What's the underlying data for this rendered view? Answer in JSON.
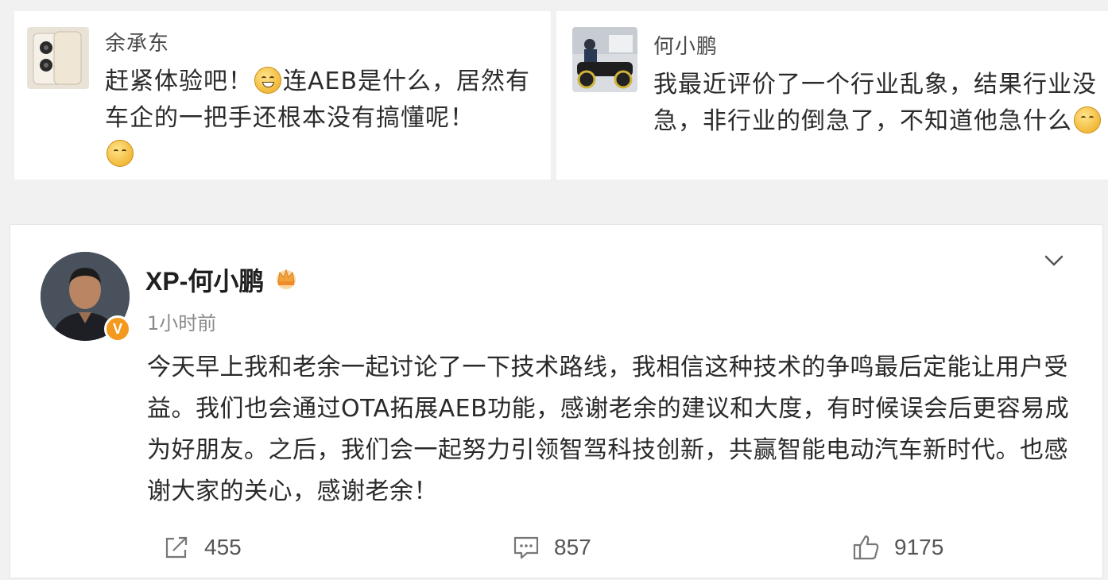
{
  "comment_left": {
    "author": "余承东",
    "text": "赶紧体验吧！😁连AEB是什么，居然有车企的一把手还根本没有搞懂呢！🤭",
    "avatar_icon": "phone-product-avatar"
  },
  "comment_right": {
    "author": "何小鹏",
    "text": "我最近评价了一个行业乱象，结果行业没急，非行业的倒急了，不知道他急什么🤭",
    "avatar_icon": "person-on-vehicle-avatar"
  },
  "post": {
    "author": "XP-何小鹏",
    "time": "1小时前",
    "verified_badge": "V",
    "body": "今天早上我和老余一起讨论了一下技术路线，我相信这种技术的争鸣最后定能让用户受益。我们也会通过OTA拓展AEB功能，感谢老余的建议和大度，有时候误会后更容易成为好朋友。之后，我们会一起努力引领智驾科技创新，共赢智能电动汽车新时代。也感谢大家的关心，感谢老余！",
    "shares": "455",
    "comments": "857",
    "likes": "9175"
  },
  "colors": {
    "badge_orange": "#f39a1e",
    "text_dark": "#2a2a2a",
    "text_muted": "#8a8a8a"
  }
}
